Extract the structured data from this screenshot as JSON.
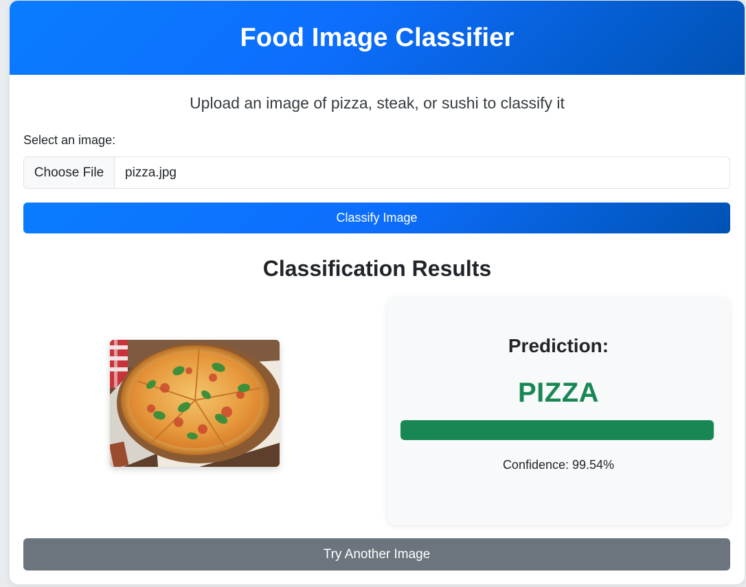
{
  "header": {
    "title": "Food Image Classifier"
  },
  "subtitle": "Upload an image of pizza, steak, or sushi to classify it",
  "form": {
    "label": "Select an image:",
    "choose_file_label": "Choose File",
    "file_name": "pizza.jpg",
    "classify_label": "Classify Image"
  },
  "results": {
    "title": "Classification Results",
    "image_icon": "pizza-photo",
    "prediction_label": "Prediction:",
    "prediction_value": "PIZZA",
    "confidence_percent": 99.54,
    "confidence_text": "Confidence: 99.54%"
  },
  "actions": {
    "retry_label": "Try Another Image"
  },
  "colors": {
    "primary": "#0d6efd",
    "primary_dark": "#0052b3",
    "success": "#198754",
    "secondary": "#6c757d"
  }
}
